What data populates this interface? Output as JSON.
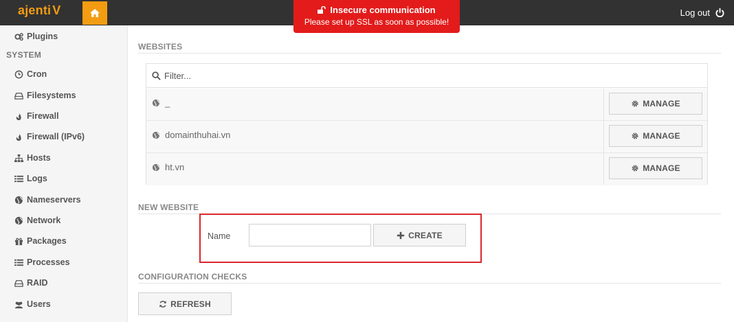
{
  "brand": {
    "name": "ajenti",
    "suffix": "V"
  },
  "alert": {
    "title": "Insecure communication",
    "message": "Please set up SSL as soon as possible!"
  },
  "header": {
    "logout_label": "Log out"
  },
  "sidebar": {
    "top_item": {
      "label": "Plugins",
      "icon": "cogs-icon"
    },
    "section_label": "SYSTEM",
    "items": [
      {
        "label": "Cron",
        "icon": "clock-icon"
      },
      {
        "label": "Filesystems",
        "icon": "hdd-icon"
      },
      {
        "label": "Firewall",
        "icon": "fire-icon"
      },
      {
        "label": "Firewall (IPv6)",
        "icon": "fire-icon"
      },
      {
        "label": "Hosts",
        "icon": "sitemap-icon"
      },
      {
        "label": "Logs",
        "icon": "list-icon"
      },
      {
        "label": "Nameservers",
        "icon": "globe-icon"
      },
      {
        "label": "Network",
        "icon": "globe-icon"
      },
      {
        "label": "Packages",
        "icon": "gift-icon"
      },
      {
        "label": "Processes",
        "icon": "list-icon"
      },
      {
        "label": "RAID",
        "icon": "hdd-icon"
      },
      {
        "label": "Users",
        "icon": "users-icon"
      }
    ]
  },
  "websites": {
    "section_title": "WEBSITES",
    "filter_placeholder": "Filter...",
    "manage_label": "MANAGE",
    "sites": [
      {
        "name": "_"
      },
      {
        "name": "domainthuhai.vn"
      },
      {
        "name": "ht.vn"
      }
    ]
  },
  "new_website": {
    "section_title": "NEW WEBSITE",
    "name_label": "Name",
    "name_value": "",
    "create_label": "CREATE"
  },
  "config_checks": {
    "section_title": "CONFIGURATION CHECKS",
    "refresh_label": "REFRESH"
  },
  "colors": {
    "accent": "#f39c12",
    "alert": "#e31b1b",
    "topbar": "#323232",
    "highlight_box": "#d8282d"
  }
}
